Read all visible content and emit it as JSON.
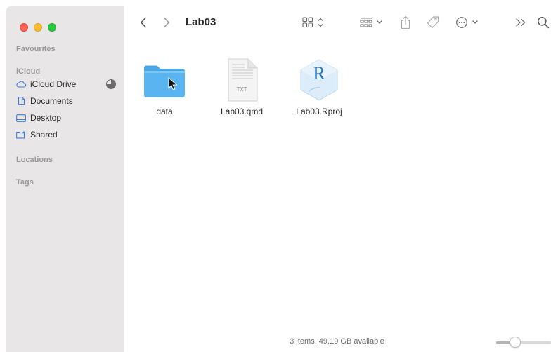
{
  "window": {
    "title": "Lab03"
  },
  "sidebar": {
    "sections": {
      "favourites": "Favourites",
      "icloud": "iCloud",
      "locations": "Locations",
      "tags": "Tags"
    },
    "items": [
      {
        "label": "iCloud Drive",
        "icon": "cloud-icon"
      },
      {
        "label": "Documents",
        "icon": "document-icon"
      },
      {
        "label": "Desktop",
        "icon": "desktop-icon"
      },
      {
        "label": "Shared",
        "icon": "shared-folder-icon"
      }
    ]
  },
  "toolbar": {
    "back_icon": "chevron-left-icon",
    "forward_icon": "chevron-right-icon",
    "view_icon": "icon-grid-icon",
    "group_icon": "group-by-icon",
    "share_icon": "share-icon",
    "tag_icon": "tag-icon",
    "more_icon": "more-options-icon",
    "overflow_icon": "double-chevron-right-icon",
    "search_icon": "search-icon"
  },
  "files": [
    {
      "name": "data",
      "kind": "folder"
    },
    {
      "name": "Lab03.qmd",
      "kind": "text-file",
      "badge": "TXT"
    },
    {
      "name": "Lab03.Rproj",
      "kind": "rproj-file",
      "badge": "R"
    }
  ],
  "status": {
    "text": "3 items, 49.19 GB available",
    "zoom_fraction": 0.3
  },
  "colors": {
    "sidebar_bg": "#e8e6e6",
    "folder_blue": "#5ab4f0",
    "traffic_close": "#fe5f57",
    "traffic_min": "#febc2e",
    "traffic_max": "#28c840"
  }
}
